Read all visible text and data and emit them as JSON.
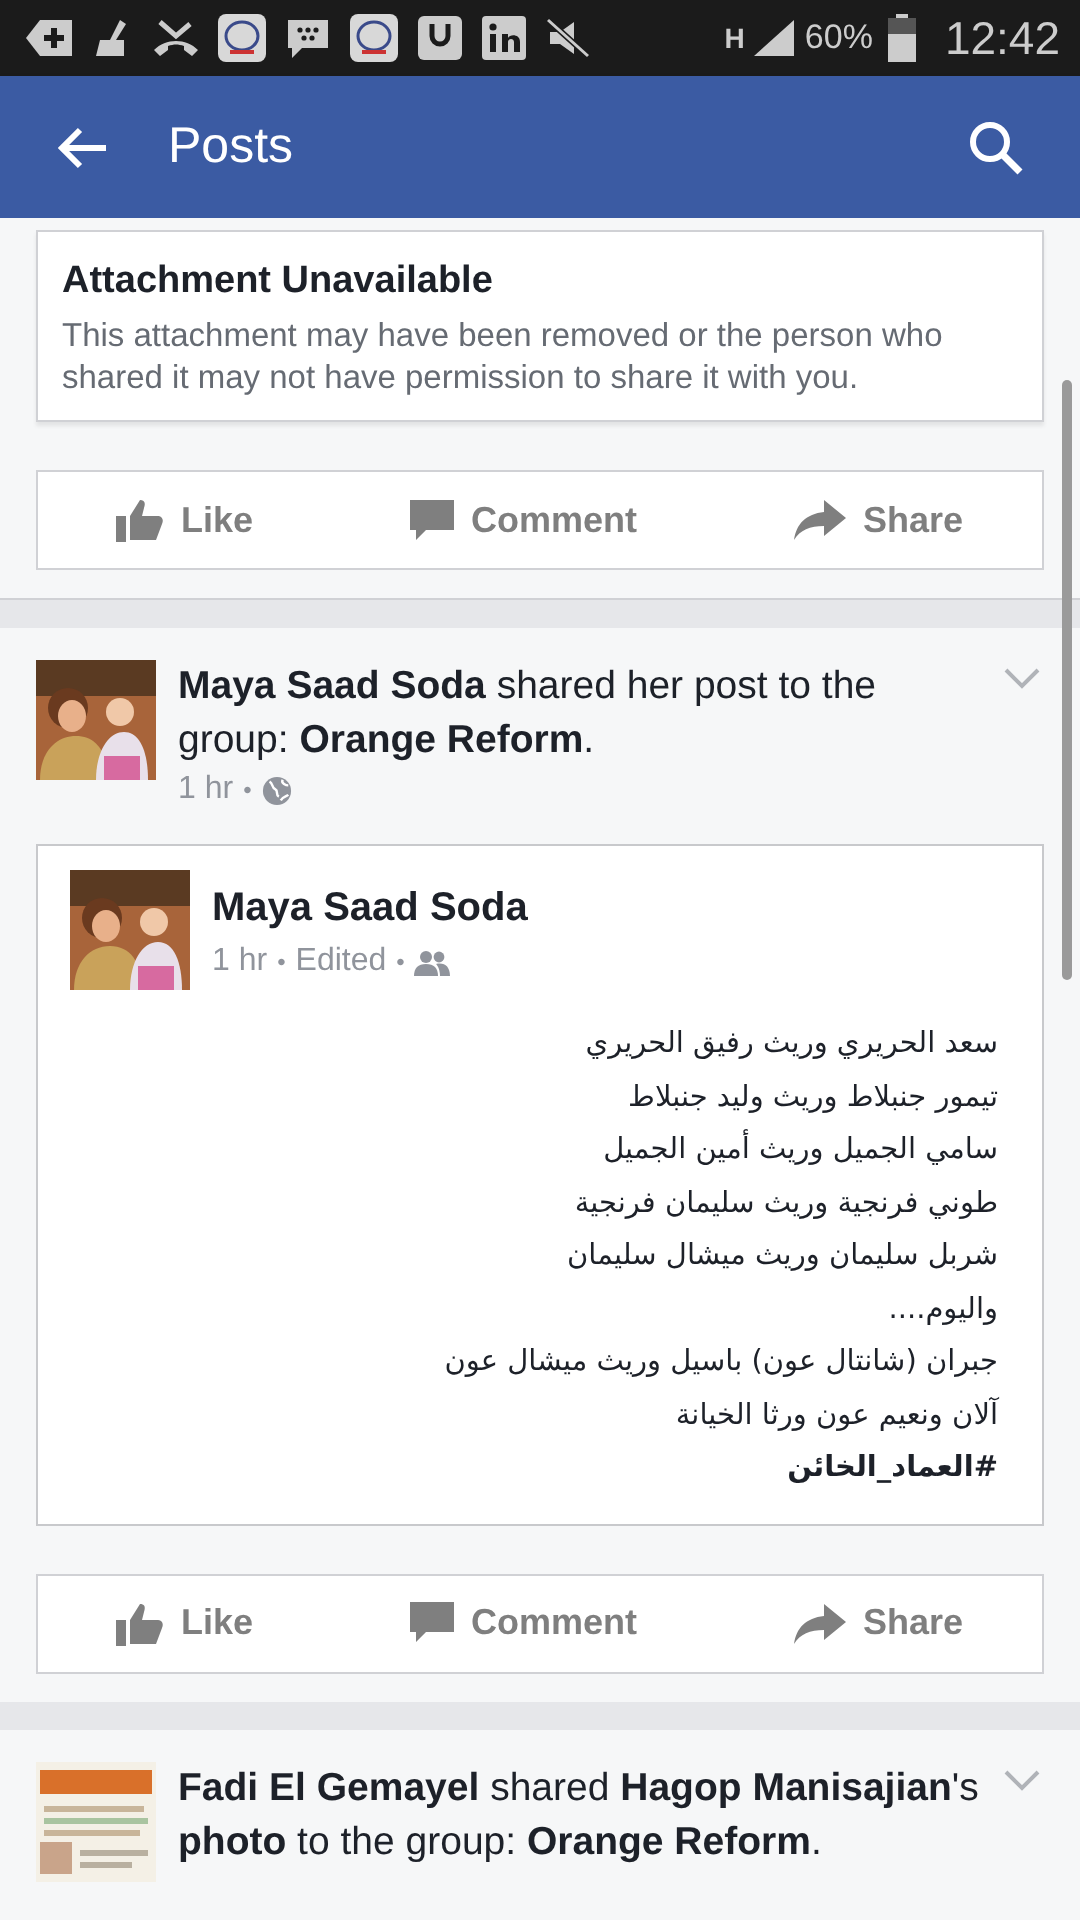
{
  "status_bar": {
    "network": "H",
    "battery": "60%",
    "time": "12:42"
  },
  "app_bar": {
    "title": "Posts"
  },
  "posts": [
    {
      "kind": "attachment",
      "attachment": {
        "title": "Attachment Unavailable",
        "body": "This attachment may have been removed or the person who shared it may not have permission to share it with you."
      },
      "actions": [
        "Like",
        "Comment",
        "Share"
      ]
    },
    {
      "kind": "shared",
      "headline": "**Maya Saad Soda** shared her post to the group: **Orange Reform**.",
      "time": "1 hr",
      "separator": "•",
      "audience": {
        "kind": "public"
      },
      "inner": {
        "author": "Maya Saad Soda",
        "time": "1 hr",
        "edited": "Edited",
        "separator": "•",
        "audience": {
          "kind": "friends"
        },
        "lines": [
          {
            "text": "سعد الحريري وريث رفيق الحريري",
            "bold": false
          },
          {
            "text": "تيمور جنبلاط وريث وليد جنبلاط",
            "bold": false
          },
          {
            "text": "سامي الجميل وريث أمين الجميل",
            "bold": false
          },
          {
            "text": "طوني فرنجية وريث سليمان فرنجية",
            "bold": false
          },
          {
            "text": "شربل سليمان وريث ميشال سليمان",
            "bold": false
          },
          {
            "text": "واليوم....",
            "bold": false
          },
          {
            "text": "جبران (شانتال عون) باسيل وريث ميشال عون",
            "bold": false
          },
          {
            "text": "آلان ونعيم عون ورثا الخيانة",
            "bold": false
          },
          {
            "text": "#العماد_الخائن",
            "bold": true
          }
        ]
      },
      "actions": [
        "Like",
        "Comment",
        "Share"
      ]
    },
    {
      "headline": "**Fadi El Gemayel** shared **Hagop Manisajian**'s **photo** to the group: **Orange Reform**."
    }
  ]
}
